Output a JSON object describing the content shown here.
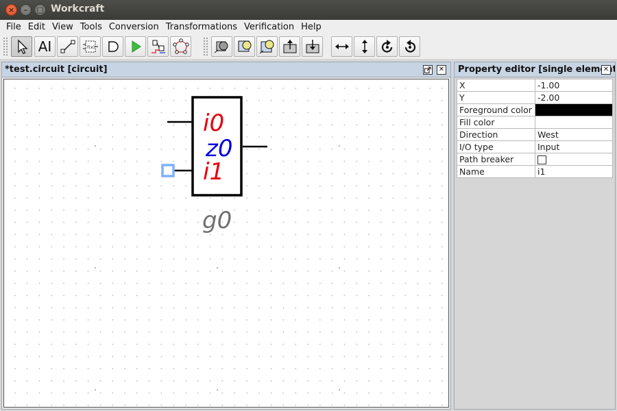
{
  "window": {
    "title": "Workcraft"
  },
  "menu": [
    "File",
    "Edit",
    "View",
    "Tools",
    "Conversion",
    "Transformations",
    "Verification",
    "Help"
  ],
  "toolbar": {
    "buttons": [
      "select-tool",
      "text-tool",
      "connect-tool",
      "function-component-tool",
      "gate-tool",
      "simulation-tool",
      "encoding-tool",
      "cycle-tool",
      "contract-tool",
      "bubble-tool",
      "initial-state-tool",
      "push-up-tool",
      "push-down-tool",
      "flip-horizontal-tool",
      "flip-vertical-tool",
      "rotate-clockwise-tool",
      "rotate-counterclockwise-tool"
    ],
    "text_tool_label": "AI"
  },
  "editor": {
    "title": "*test.circuit [circuit]",
    "circuit": {
      "component_name": "g0",
      "output_label": "z0",
      "input_labels": [
        "i0",
        "i1"
      ],
      "colors": {
        "input": "#e8000a",
        "output": "#0000e0",
        "name": "#707070",
        "selection": "#7fb0ff"
      }
    }
  },
  "property_editor": {
    "title": "Property editor [single element]",
    "rows": [
      {
        "key": "X",
        "value": "-1.00"
      },
      {
        "key": "Y",
        "value": "-2.00"
      },
      {
        "key": "Foreground color",
        "value": "",
        "swatch": "#000000"
      },
      {
        "key": "Fill color",
        "value": "",
        "swatch": "#ffffff"
      },
      {
        "key": "Direction",
        "value": "West"
      },
      {
        "key": "I/O type",
        "value": "Input"
      },
      {
        "key": "Path breaker",
        "value": "",
        "checkbox": false
      },
      {
        "key": "Name",
        "value": "i1"
      }
    ]
  }
}
